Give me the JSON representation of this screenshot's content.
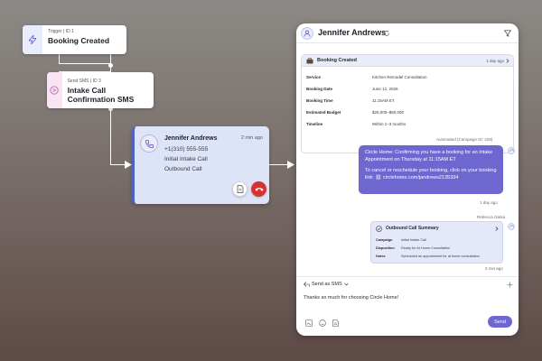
{
  "workflow": {
    "trigger_node": {
      "meta": "Trigger | ID 1",
      "title": "Booking Created"
    },
    "sms_node": {
      "meta": "Send SMS | ID 3",
      "title": "Intake Call Confirmation SMS"
    },
    "call_card": {
      "name": "Jennifer Andrews",
      "time": "2 min ago",
      "phone": "+1(310) 555-555",
      "line1": "Initial Intake Call",
      "line2": "Outbound Call"
    }
  },
  "panel": {
    "contact_name": "Jennifer Andrews",
    "booking": {
      "title": "Booking Created",
      "ago": "1 day ago",
      "rows": [
        {
          "key": "Service",
          "value": "Kitchen Remodel Consultation"
        },
        {
          "key": "Booking Date",
          "value": "June 12, 2026"
        },
        {
          "key": "Booking Time",
          "value": "11:15AM ET"
        },
        {
          "key": "Estimated Budget",
          "value": "$25,000–$50,000"
        },
        {
          "key": "Timeline",
          "value": "Within 1–3 months"
        }
      ]
    },
    "sms_message": {
      "sender_label": "Automated (Campaign ID: 429)",
      "text_1": "Circle Home: Confirming you have a booking for an Intake Appointment on Thursday at 11:15AM ET",
      "text_2": "To cancel or reschedule your booking, click on your booking link:",
      "link": "circlehome.com/jandrews2135334",
      "ago": "1 day ago"
    },
    "summary": {
      "sender_label": "Rebecca Gatsa",
      "title": "Outbound Call Summary",
      "rows": [
        {
          "key": "Campaign",
          "value": "Initial Intake Call"
        },
        {
          "key": "Disposition",
          "value": "Ready for At Home Consultation"
        },
        {
          "key": "Notes",
          "value": "Scheduled an appointment for at home consultation"
        }
      ],
      "ago": "3 min ago"
    },
    "composer": {
      "send_as": "Send as SMS",
      "text": "Thanks so much for choosing Circle Home!",
      "send_label": "Send"
    }
  },
  "colors": {
    "accent": "#6e67cf",
    "call_card": "#dde4f8",
    "hangup": "#d6322f"
  }
}
